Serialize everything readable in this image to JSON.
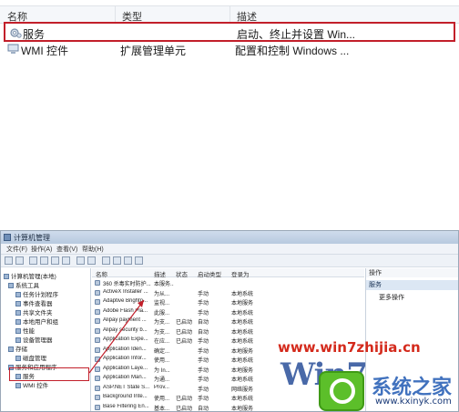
{
  "top_panel": {
    "columns": [
      "名称",
      "类型",
      "描述"
    ],
    "rows": [
      {
        "name": "服务",
        "type": "",
        "desc": "启动、终止并设置 Win...",
        "selected": true
      },
      {
        "name": "WMI 控件",
        "type": "扩展管理单元",
        "desc": "配置和控制 Windows ...",
        "selected": false
      }
    ]
  },
  "window": {
    "title": "计算机管理",
    "menu": [
      "文件(F)",
      "操作(A)",
      "查看(V)",
      "帮助(H)"
    ],
    "tree": [
      {
        "label": "计算机管理(本地)",
        "level": 0
      },
      {
        "label": "系统工具",
        "level": 1
      },
      {
        "label": "任务计划程序",
        "level": 2
      },
      {
        "label": "事件查看器",
        "level": 2
      },
      {
        "label": "共享文件夹",
        "level": 2
      },
      {
        "label": "本地用户和组",
        "level": 2
      },
      {
        "label": "性能",
        "level": 2
      },
      {
        "label": "设备管理器",
        "level": 2
      },
      {
        "label": "存储",
        "level": 1
      },
      {
        "label": "磁盘管理",
        "level": 2
      },
      {
        "label": "服务和应用程序",
        "level": 1
      },
      {
        "label": "服务",
        "level": 2
      },
      {
        "label": "WMI 控件",
        "level": 2
      }
    ],
    "list_columns": [
      "名称",
      "描述",
      "状态",
      "启动类型",
      "登录为"
    ],
    "services": [
      {
        "name": "360 杀毒实时防护...",
        "desc": "本服务...",
        "status": "",
        "startup": "",
        "logon": ""
      },
      {
        "name": "ActiveX Installer ...",
        "desc": "为从...",
        "status": "",
        "startup": "手动",
        "logon": "本地系统"
      },
      {
        "name": "Adaptive Brightn...",
        "desc": "监视...",
        "status": "",
        "startup": "手动",
        "logon": "本地服务"
      },
      {
        "name": "Adobe Flash Pla...",
        "desc": "此服...",
        "status": "",
        "startup": "手动",
        "logon": "本地系统"
      },
      {
        "name": "Alipay payment ...",
        "desc": "为支...",
        "status": "已启动",
        "startup": "自动",
        "logon": "本地系统"
      },
      {
        "name": "Alipay security b...",
        "desc": "为支...",
        "status": "已启动",
        "startup": "自动",
        "logon": "本地系统"
      },
      {
        "name": "Application Expe...",
        "desc": "在应...",
        "status": "已启动",
        "startup": "手动",
        "logon": "本地系统"
      },
      {
        "name": "Application Iden...",
        "desc": "确定...",
        "status": "",
        "startup": "手动",
        "logon": "本地服务"
      },
      {
        "name": "Application Infor...",
        "desc": "使用...",
        "status": "",
        "startup": "手动",
        "logon": "本地系统"
      },
      {
        "name": "Application Laye...",
        "desc": "为 In...",
        "status": "",
        "startup": "手动",
        "logon": "本地服务"
      },
      {
        "name": "Application Man...",
        "desc": "为通...",
        "status": "",
        "startup": "手动",
        "logon": "本地系统"
      },
      {
        "name": "ASP.NET State S...",
        "desc": "Prov...",
        "status": "",
        "startup": "手动",
        "logon": "网络服务"
      },
      {
        "name": "Background Inte...",
        "desc": "使用...",
        "status": "已启动",
        "startup": "手动",
        "logon": "本地系统"
      },
      {
        "name": "Base Filtering En...",
        "desc": "基本...",
        "status": "已启动",
        "startup": "自动",
        "logon": "本地服务"
      }
    ],
    "actions": {
      "header": "操作",
      "section": "服务",
      "more": "更多操作"
    }
  },
  "watermark": {
    "url": "www.win7zhijia.cn",
    "logo": "Win7",
    "cn": "系统之家",
    "site": "www.kxinyk.com"
  },
  "colors": {
    "highlight_border": "#c21f2a",
    "watermark_red": "#d42a1c",
    "watermark_blue": "#2a4f9a",
    "watermark_green": "#5cbf2a"
  }
}
